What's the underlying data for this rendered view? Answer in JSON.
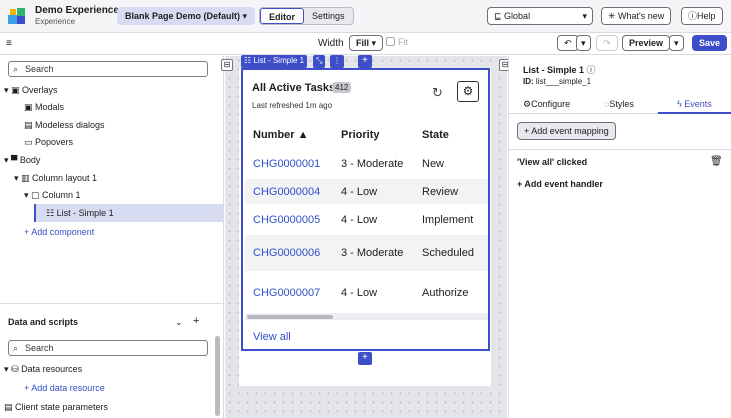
{
  "app": {
    "title": "Demo Experience",
    "subtitle": "Experience",
    "page_selector": "Blank Page Demo (Default)",
    "tabs": [
      "Editor",
      "Settings"
    ],
    "scope": "Global",
    "whats_new": "What's new",
    "help": "Help"
  },
  "toolbar2": {
    "width_label": "Width",
    "width_value": "Fill",
    "fit_label": "Fit",
    "preview": "Preview",
    "save": "Save"
  },
  "tree": {
    "search_placeholder": "Search",
    "items": [
      "Overlays",
      "Modals",
      "Modeless dialogs",
      "Popovers",
      "Body",
      "Column layout 1",
      "Column 1",
      "List - Simple 1"
    ],
    "add_component": "+ Add component"
  },
  "data_scripts": {
    "title": "Data and scripts",
    "search_placeholder": "Search",
    "data_resources": "Data resources",
    "add_data_resource": "+ Add data resource",
    "client_state": "Client state parameters"
  },
  "canvas": {
    "selected_tag": "List - Simple 1",
    "add_top": "+",
    "add_bottom": "+"
  },
  "list": {
    "title": "All Active Tasks",
    "count": "412",
    "refreshed": "Last refreshed 1m ago",
    "columns": [
      "Number ▲",
      "Priority",
      "State"
    ],
    "rows": [
      [
        "CHG0000001",
        "3 - Moderate",
        "New"
      ],
      [
        "CHG0000004",
        "4 - Low",
        "Review"
      ],
      [
        "CHG0000005",
        "4 - Low",
        "Implement"
      ],
      [
        "CHG0000006",
        "3 - Moderate",
        "Scheduled"
      ],
      [
        "CHG0000007",
        "4 - Low",
        "Authorize"
      ]
    ],
    "view_all": "View all"
  },
  "panel": {
    "title": "List - Simple 1",
    "id_label": "ID:",
    "id_value": "list___simple_1",
    "tabs": [
      "Configure",
      "Styles",
      "Events"
    ],
    "add_mapping": "+ Add event mapping",
    "event_name": "'View all' clicked",
    "add_handler": "+ Add event handler"
  },
  "colors": {
    "accent": "#3e4ec8",
    "link": "#2f50c6"
  }
}
